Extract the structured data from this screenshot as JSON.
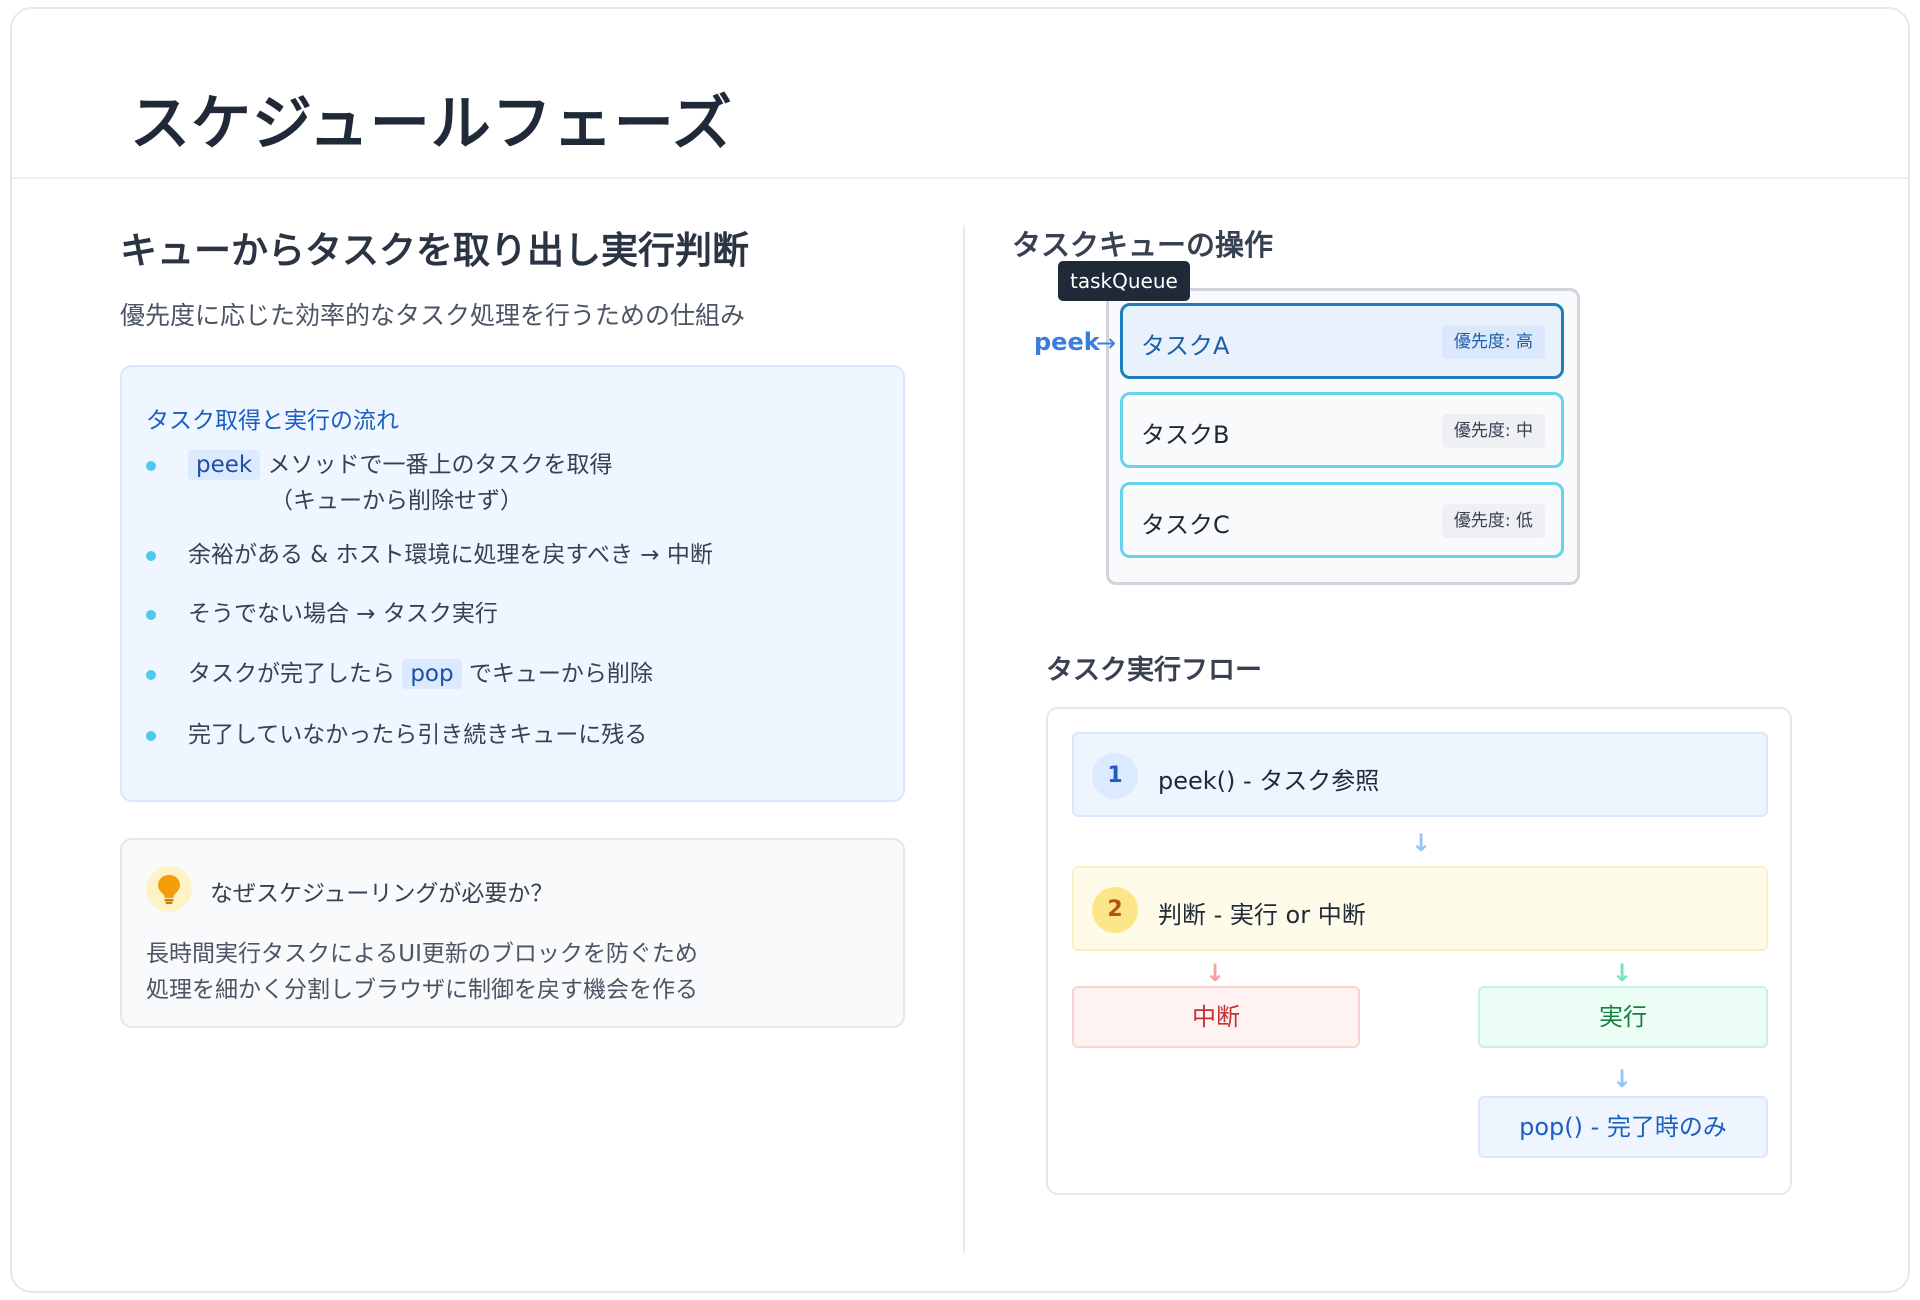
{
  "header": {
    "title": "スケジュールフェーズ"
  },
  "left": {
    "title": "キューからタスクを取り出し実行判断",
    "subtitle": "優先度に応じた効率的なタスク処理を行うための仕組み",
    "flow": {
      "title": "タスク取得と実行の流れ",
      "items": [
        {
          "code": "peek",
          "text": " メソッドで一番上のタスクを取得",
          "sub": "（キューから削除せず）"
        },
        {
          "text": "余裕がある & ホスト環境に処理を戻すべき → 中断"
        },
        {
          "text": "そうでない場合 → タスク実行"
        },
        {
          "pre": "タスクが完了したら ",
          "code": "pop",
          "post": " でキューから削除"
        },
        {
          "text": "完了していなかったら引き続きキューに残る"
        }
      ]
    },
    "why": {
      "icon": "lightbulb-icon",
      "title": "なぜスケジューリングが必要か？",
      "lines": [
        "長時間実行タスクによるUI更新のブロックを防ぐため",
        "処理を細かく分割しブラウザに制御を戻す機会を作る"
      ]
    }
  },
  "queue": {
    "heading": "タスクキューの操作",
    "tag": "taskQueue",
    "peek_label": "peek",
    "peek_arrow": "→",
    "tasks": [
      {
        "name": "タスクA",
        "priority": "優先度: 高"
      },
      {
        "name": "タスクB",
        "priority": "優先度: 中"
      },
      {
        "name": "タスクC",
        "priority": "優先度: 低"
      }
    ]
  },
  "exec_flow": {
    "heading": "タスク実行フロー",
    "steps": [
      {
        "num": "1",
        "label": "peek() - タスク参照"
      },
      {
        "num": "2",
        "label": "判断 - 実行 or 中断"
      }
    ],
    "arrow": "↓",
    "abort": "中断",
    "execute": "実行",
    "pop": "pop() - 完了時のみ"
  },
  "colors": {
    "accent_blue": "#1d5fc0",
    "bullet": "#4fc9ec",
    "abort_red": "#c53030",
    "exec_green": "#15803d",
    "highlight_border": "#1e7eb8"
  }
}
